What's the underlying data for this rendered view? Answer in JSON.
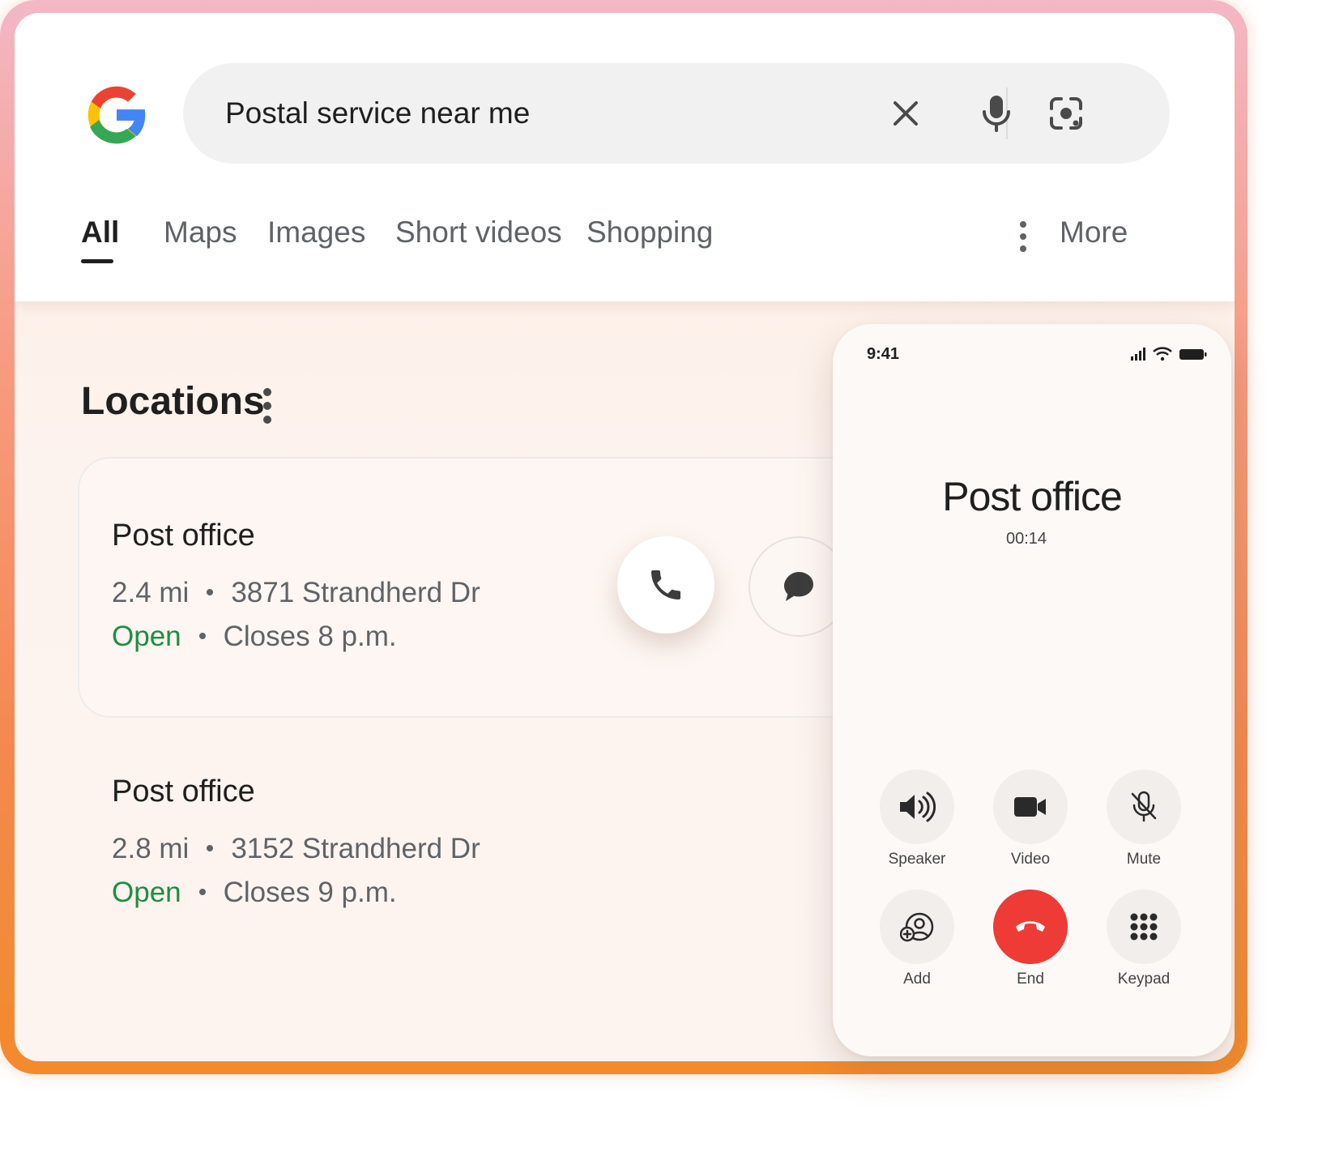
{
  "search": {
    "query": "Postal service near me"
  },
  "tabs": [
    {
      "label": "All",
      "active": true
    },
    {
      "label": "Maps"
    },
    {
      "label": "Images"
    },
    {
      "label": "Short videos"
    },
    {
      "label": "Shopping"
    }
  ],
  "more_label": "More",
  "section": {
    "title": "Locations"
  },
  "results": [
    {
      "title": "Post office",
      "distance": "2.4 mi",
      "address": "3871  Strandherd Dr",
      "status": "Open",
      "closes": "Closes 8 p.m."
    },
    {
      "title": "Post office",
      "distance": "2.8 mi",
      "address": "3152  Strandherd Dr",
      "status": "Open",
      "closes": "Closes 9 p.m."
    }
  ],
  "phone": {
    "time": "9:41",
    "callee": "Post office",
    "timer": "00:14",
    "controls": [
      {
        "label": "Speaker",
        "icon": "speaker-icon"
      },
      {
        "label": "Video",
        "icon": "video-icon"
      },
      {
        "label": "Mute",
        "icon": "mic-off-icon"
      },
      {
        "label": "Add",
        "icon": "add-person-icon"
      },
      {
        "label": "End",
        "icon": "end-call-icon"
      },
      {
        "label": "Keypad",
        "icon": "keypad-icon"
      }
    ]
  },
  "colors": {
    "open_green": "#1e8e3e",
    "end_red": "#ee3b36",
    "google_blue": "#4285F4",
    "google_red": "#EA4335",
    "google_yellow": "#FBBC05",
    "google_green": "#34A853"
  }
}
